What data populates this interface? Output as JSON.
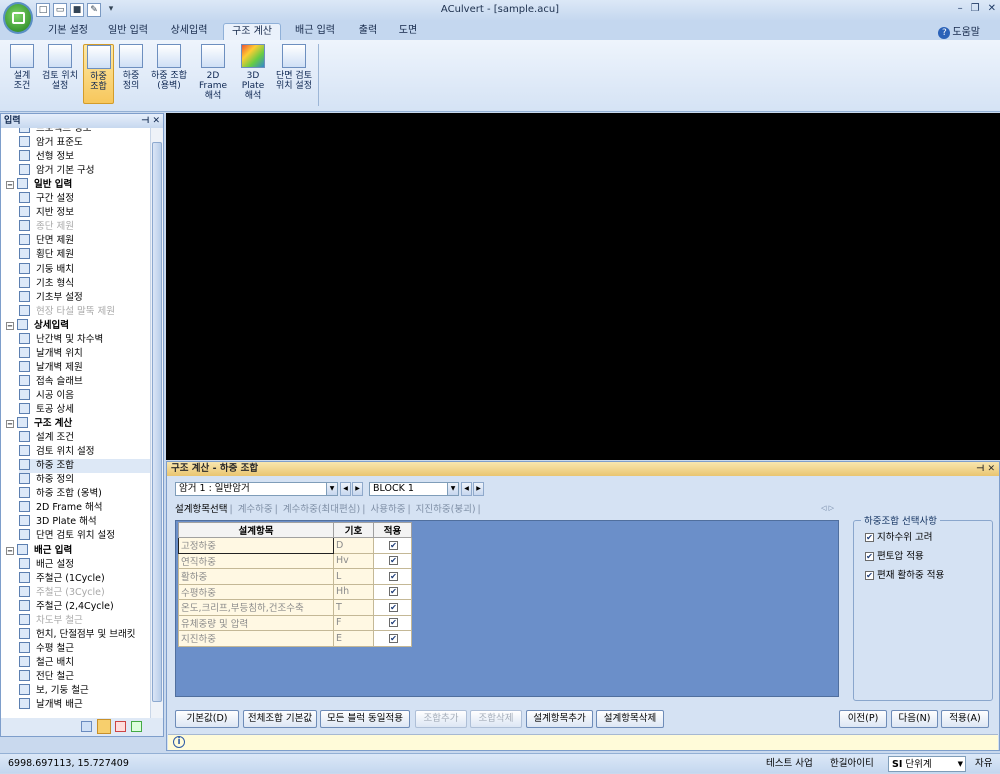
{
  "window": {
    "title": "ACulvert - [sample.acu]"
  },
  "quick_access": [
    "new-icon",
    "open-icon",
    "save-icon",
    "edit-icon",
    "dropdown-icon"
  ],
  "menu_tabs": [
    "기본 설정",
    "일반 입력",
    "상세입력",
    "구조 계산",
    "배근 입력",
    "출력",
    "도면"
  ],
  "active_tab": "구조 계산",
  "help_label": "도움말",
  "ribbon_buttons": [
    {
      "l1": "설계",
      "l2": "조건"
    },
    {
      "l1": "검토 위치",
      "l2": "설정"
    },
    {
      "l1": "하중",
      "l2": "조합"
    },
    {
      "l1": "하중",
      "l2": "정의"
    },
    {
      "l1": "하중 조합",
      "l2": "(용벽)"
    },
    {
      "l1": "2D Frame",
      "l2": "해석"
    },
    {
      "l1": "3D Plate",
      "l2": "해석"
    },
    {
      "l1": "단면 검토",
      "l2": "위치 설정"
    }
  ],
  "sidebar": {
    "title": "입력",
    "items": [
      {
        "label": "프로젝트 정보",
        "type": "item"
      },
      {
        "label": "암거 표준도",
        "type": "item"
      },
      {
        "label": "선형 정보",
        "type": "item"
      },
      {
        "label": "암거 기본 구성",
        "type": "item"
      },
      {
        "label": "일반 입력",
        "type": "group"
      },
      {
        "label": "구간 설정",
        "type": "item"
      },
      {
        "label": "지반 정보",
        "type": "item"
      },
      {
        "label": "종단 제원",
        "type": "disabled"
      },
      {
        "label": "단면 제원",
        "type": "item"
      },
      {
        "label": "횡단 제원",
        "type": "item"
      },
      {
        "label": "기둥 배치",
        "type": "item"
      },
      {
        "label": "기초 형식",
        "type": "item"
      },
      {
        "label": "기초부 설정",
        "type": "item"
      },
      {
        "label": "현장 타설 말뚝 제원",
        "type": "disabled"
      },
      {
        "label": "상세입력",
        "type": "group"
      },
      {
        "label": "난간벽 및 차수벽",
        "type": "item"
      },
      {
        "label": "날개벽 위치",
        "type": "item"
      },
      {
        "label": "날개벽 제원",
        "type": "item"
      },
      {
        "label": "접속 슬래브",
        "type": "item"
      },
      {
        "label": "시공 이음",
        "type": "item"
      },
      {
        "label": "토공 상세",
        "type": "item"
      },
      {
        "label": "구조 계산",
        "type": "group"
      },
      {
        "label": "설계 조건",
        "type": "item"
      },
      {
        "label": "검토 위치 설정",
        "type": "item"
      },
      {
        "label": "하중 조합",
        "type": "selected"
      },
      {
        "label": "하중 정의",
        "type": "item"
      },
      {
        "label": "하중 조합 (옹벽)",
        "type": "item"
      },
      {
        "label": "2D Frame 해석",
        "type": "item"
      },
      {
        "label": "3D Plate 해석",
        "type": "item"
      },
      {
        "label": "단면 검토 위치 설정",
        "type": "item"
      },
      {
        "label": "배근 입력",
        "type": "group"
      },
      {
        "label": "배근 설정",
        "type": "item"
      },
      {
        "label": "주철근 (1Cycle)",
        "type": "item"
      },
      {
        "label": "주철근 (3Cycle)",
        "type": "disabled"
      },
      {
        "label": "주철근 (2,4Cycle)",
        "type": "item"
      },
      {
        "label": "차도부 철근",
        "type": "disabled"
      },
      {
        "label": "헌치, 단절점부 및 브래킷",
        "type": "item"
      },
      {
        "label": "수평 철근",
        "type": "item"
      },
      {
        "label": "철근 배치",
        "type": "item"
      },
      {
        "label": "전단 철근",
        "type": "item"
      },
      {
        "label": "보, 기둥 철근",
        "type": "item"
      },
      {
        "label": "날개벽 배근",
        "type": "item"
      }
    ]
  },
  "panel": {
    "title": "구조 계산 - 하중 조합",
    "culvert_select": "암거 1 : 일반암거",
    "block_select": "BLOCK  1",
    "subtabs": [
      "설계항목선택",
      "계수하중",
      "계수하중(최대편심)",
      "사용하중",
      "지진하중(붕괴)"
    ],
    "active_subtab": "설계항목선택",
    "table": {
      "headers": [
        "설계항목",
        "기호",
        "적용"
      ],
      "rows": [
        {
          "name": "고정하중",
          "sym": "D",
          "apply": true
        },
        {
          "name": "연직하중",
          "sym": "Hv",
          "apply": true
        },
        {
          "name": "활하중",
          "sym": "L",
          "apply": true
        },
        {
          "name": "수평하중",
          "sym": "Hh",
          "apply": true
        },
        {
          "name": "온도,크리프,부등침하,건조수축",
          "sym": "T",
          "apply": true
        },
        {
          "name": "유체중량 및 압력",
          "sym": "F",
          "apply": true
        },
        {
          "name": "지진하중",
          "sym": "E",
          "apply": true
        }
      ]
    },
    "options_title": "하중조합 선택사항",
    "options": [
      {
        "label": "지하수위 고려",
        "checked": true
      },
      {
        "label": "편토압 적용",
        "checked": true
      },
      {
        "label": "편재 활하중 적용",
        "checked": true
      }
    ],
    "buttons": {
      "default": "기본값(D)",
      "all_default": "전체조합 기본값",
      "apply_all_blocks": "모든 블럭 동일적용",
      "add_combo": "조합추가",
      "del_combo": "조합삭제",
      "add_item": "설계항목추가",
      "del_item": "설계항목삭제",
      "prev": "이전(P)",
      "next": "다음(N)",
      "apply": "적용(A)"
    }
  },
  "status": {
    "coords": "6998.697113,     15.727409",
    "project": "테스트 사업",
    "user": "한길아이티",
    "unit_prefix": "SI",
    "unit": "단위계",
    "mode": "자유"
  },
  "colors": {
    "accent": "#f7c75c",
    "canvas": "#000000",
    "grid_bg": "#6b8fc9"
  }
}
